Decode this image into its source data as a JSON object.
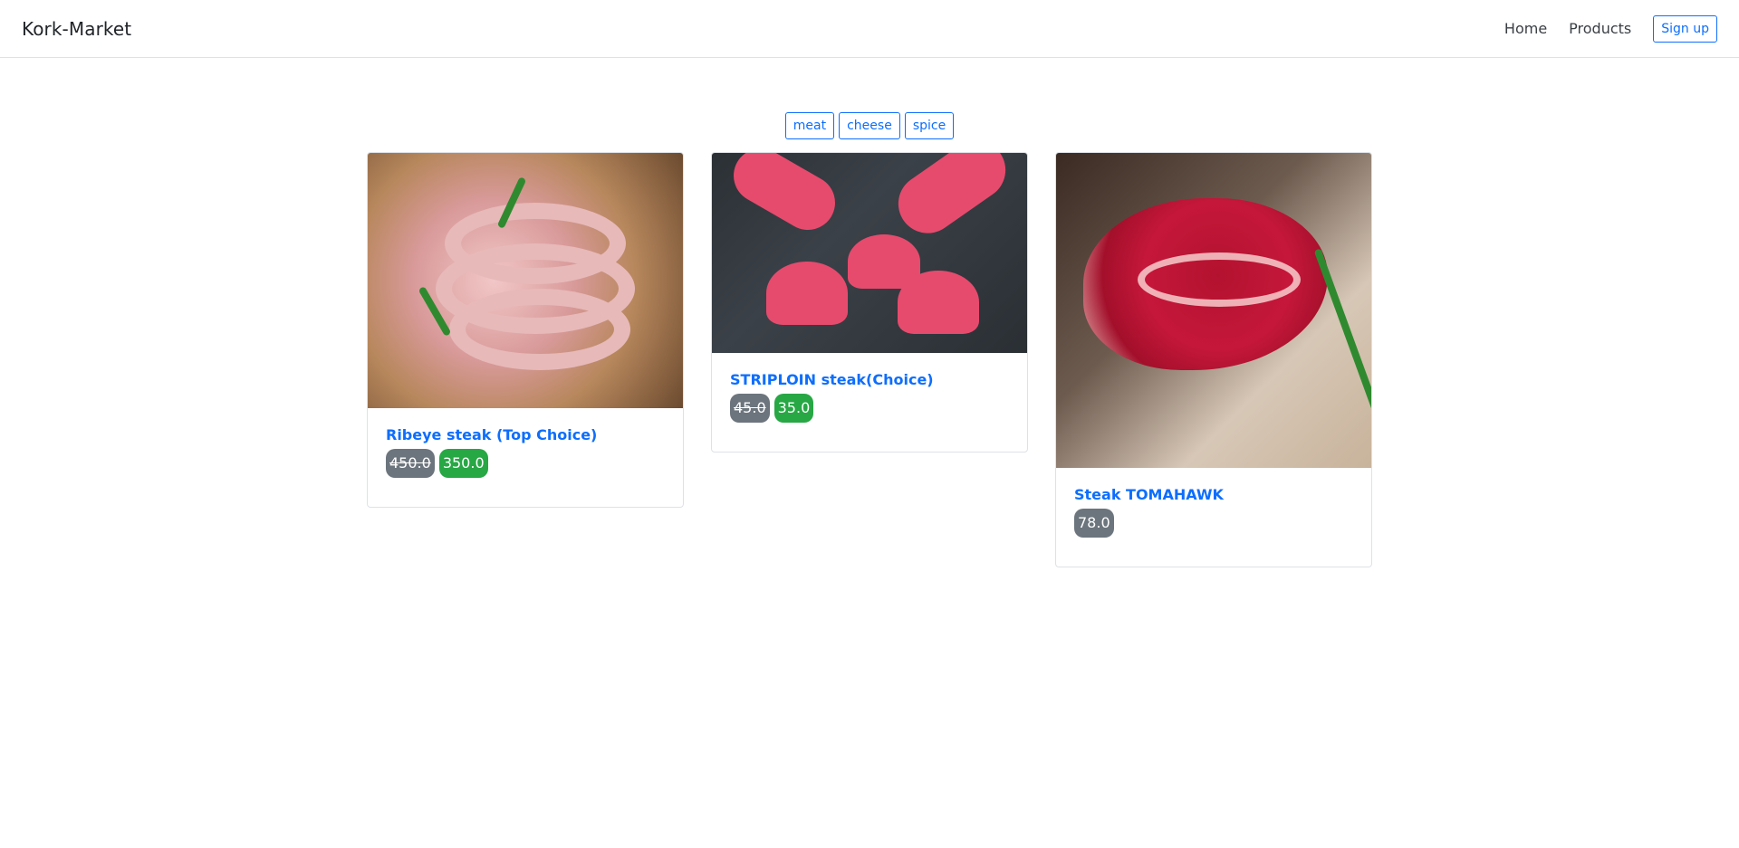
{
  "navbar": {
    "brand": "Kork-Market",
    "links": [
      "Home",
      "Products"
    ],
    "signup": "Sign up"
  },
  "filters": [
    "meat",
    "cheese",
    "spice"
  ],
  "products": [
    {
      "title": "Ribeye steak (Top Choice)",
      "old_price": "450.0",
      "new_price": "350.0",
      "image": "sausage-on-board"
    },
    {
      "title": "STRIPLOIN steak(Choice)",
      "old_price": "45.0",
      "new_price": "35.0",
      "image": "tuna-cuts"
    },
    {
      "title": "Steak TOMAHAWK",
      "price": "78.0",
      "image": "raw-steak"
    }
  ]
}
